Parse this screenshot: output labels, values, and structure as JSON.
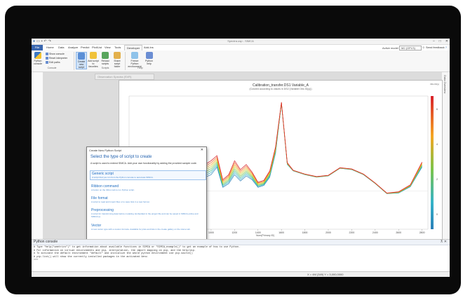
{
  "titlebar": {
    "title": "Spectra.usp - SIMCA",
    "qat_icons": [
      "simca-logo-icon",
      "new-icon",
      "save-icon",
      "undo-icon",
      "redo-icon"
    ]
  },
  "menu": {
    "tabs": [
      "File",
      "Home",
      "Data",
      "Analyze",
      "Predict",
      "Plot/List",
      "View",
      "Tools",
      "Developer",
      "Add-Ins"
    ],
    "active": "Developer"
  },
  "active_model": {
    "label": "Active model",
    "value": "M2 (OPLS)"
  },
  "feedback": {
    "label": "Send feedback"
  },
  "ribbon": {
    "python_label": "Python console",
    "show_console": "Show console",
    "reset_interpreter": "Reset interpreter",
    "edit_paths": "Edit paths",
    "console_group": "Console",
    "create_script": "Create new script",
    "add_to_favorites": "Add script to favorites",
    "reload_scripts": "Reload scripts",
    "share_script": "Share script folder",
    "scripts_group": "Scripts",
    "freeze_env": "Freeze Python environment",
    "python_help": "Python help",
    "help_group": "Help"
  },
  "doc_tab": "Observation Spectra (SVR)",
  "right_pane_label": "Data Overview",
  "chart_data": {
    "type": "line",
    "title": "Calibration_transfer.DS1 Variable_A",
    "subtitle": "(Colored according to values in DS2 (Variable:Obs ID(y)))",
    "xlabel": "Num(Primary ID)",
    "x_ticks": [
      "400",
      "600",
      "800",
      "1000",
      "1200",
      "1400",
      "1600",
      "1800",
      "2000",
      "2200",
      "2400",
      "2600",
      "2800"
    ],
    "y_ticks": [
      "-5000",
      "0",
      "5000"
    ],
    "colorbar_title": "Obs ID(y)",
    "colorbar_ticks": [
      "6",
      "4",
      "2",
      "0"
    ],
    "colors": {
      "low": "#2a7fb8",
      "high": "#d8202a",
      "mid": "#7cc44a"
    },
    "series_note_values": {
      "x": [
        300,
        400,
        500,
        600,
        700,
        750,
        800,
        850,
        900,
        950,
        1000,
        1050,
        1100,
        1150,
        1200,
        1250,
        1300,
        1350,
        1400,
        1450,
        1500,
        1550,
        1600,
        1650,
        1700,
        1800,
        1900,
        2000,
        2100,
        2200,
        2300,
        2400,
        2500,
        2600,
        2700,
        2800
      ],
      "low": [
        2000,
        -200,
        -300,
        -100,
        200,
        1500,
        600,
        -600,
        1800,
        2200,
        2600,
        3800,
        600,
        1200,
        2600,
        1600,
        2400,
        1800,
        600,
        900,
        2200,
        6000,
        13800,
        4200,
        3200,
        2600,
        2200,
        2400,
        3600,
        3400,
        2600,
        1200,
        -400,
        -300,
        700,
        3800
      ],
      "high": [
        2400,
        300,
        500,
        700,
        1200,
        3200,
        1200,
        200,
        3600,
        4200,
        4800,
        5600,
        1800,
        2600,
        4800,
        3400,
        4200,
        3000,
        1400,
        1700,
        3200,
        7000,
        14000,
        4500,
        3300,
        2700,
        2300,
        2500,
        3700,
        3500,
        2700,
        1300,
        -300,
        -100,
        1000,
        4600
      ]
    }
  },
  "dialog": {
    "title": "Create New Python Script",
    "heading": "Select the type of script to create",
    "description": "A script is used to extend SIMCA. Add your own functionality by adding the provided sample code.",
    "options": [
      {
        "title": "Generic script",
        "desc": "A script that you run from the Python console to automate SIMCA."
      },
      {
        "title": "Ribbon command",
        "desc": "A button on the ribbon tab to run Python script."
      },
      {
        "title": "File format",
        "desc": "A script to read and import files or to save lists in a new format."
      },
      {
        "title": "Preprocessing",
        "desc": "A script for transforming data before modeling. Embedded in the project file and can be saved in SIMCA-online and SIMCA-Q."
      },
      {
        "title": "Vector",
        "desc": "A new vector type with a custom formula. Available for plots and lists in the create gallery on the Home tab."
      }
    ],
    "selected_index": 0,
    "cancel": "Cancel"
  },
  "console": {
    "title": "Python console",
    "lines": [
      "# Type \"help(\"umetrics\")\" to get information about available functions in SIMCA or \"SIMCA_example()\" to get an example of how to use Python.",
      "# For information on virtual environments and pip, interpolation, the import mapping on pip, and the help/pip.",
      "# To activate the default environment \"default\" and initialize the whole python environment use pip.source()",
      "# pip.list() will show the currently installed packages in the activated Venv.",
      ">>>"
    ]
  },
  "statusbar": {
    "text": "X = 4M (349) Y = 3,000,0000"
  }
}
